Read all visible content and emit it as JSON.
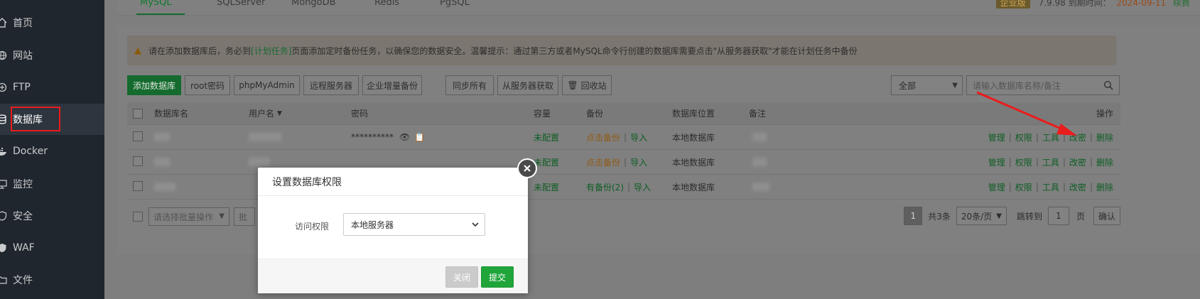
{
  "sidebar": {
    "items": [
      {
        "label": "首页",
        "icon": "home-icon"
      },
      {
        "label": "网站",
        "icon": "globe-icon"
      },
      {
        "label": "FTP",
        "icon": "ftp-icon"
      },
      {
        "label": "数据库",
        "icon": "database-icon",
        "active": true
      },
      {
        "label": "Docker",
        "icon": "docker-icon"
      },
      {
        "label": "监控",
        "icon": "monitor-icon"
      },
      {
        "label": "安全",
        "icon": "shield-icon"
      },
      {
        "label": "WAF",
        "icon": "waf-icon"
      },
      {
        "label": "文件",
        "icon": "folder-icon"
      }
    ]
  },
  "tabs": [
    {
      "label": "MySQL",
      "active": true
    },
    {
      "label": "SQLServer"
    },
    {
      "label": "MongoDB"
    },
    {
      "label": "Redis"
    },
    {
      "label": "PgSQL"
    }
  ],
  "topright": {
    "edition": "企业版",
    "version": "7.9.98",
    "expire_label": "到期时间：",
    "expire_date": "2024-09-11",
    "renew": "续费"
  },
  "notice": {
    "text_before": "请在添加数据库后，务必到",
    "link": "[计划任务]",
    "text_after": "页面添加定时备份任务，以确保您的数据安全。温馨提示：通过第三方或者MySQL命令行创建的数据库需要点击\"从服务器获取\"才能在计划任务中备份"
  },
  "toolbar": {
    "add_db": "添加数据库",
    "root_pwd": "root密码",
    "phpmyadmin": "phpMyAdmin",
    "remote_server": "远程服务器",
    "enterprise_backup": "企业增量备份",
    "sync_all": "同步所有",
    "fetch_from_server": "从服务器获取",
    "recycle_bin": "回收站",
    "filter_value": "全部",
    "search_placeholder": "请输入数据库名称/备注"
  },
  "table": {
    "headers": {
      "name": "数据库名",
      "user": "用户名",
      "password": "密码",
      "capacity": "容量",
      "backup": "备份",
      "location": "数据库位置",
      "remark": "备注",
      "actions": "操作"
    },
    "rows": [
      {
        "password": "**********",
        "capacity": "未配置",
        "backup": "点击备份",
        "import": "导入",
        "location": "本地数据库"
      },
      {
        "password": "",
        "capacity": "未配置",
        "backup": "点击备份",
        "import": "导入",
        "location": "本地数据库"
      },
      {
        "password": "",
        "capacity": "未配置",
        "backup": "有备份(2)",
        "import": "导入",
        "location": "本地数据库"
      }
    ],
    "ops": [
      "管理",
      "权限",
      "工具",
      "改密",
      "删除"
    ]
  },
  "footer": {
    "batch_placeholder": "请选择批量操作",
    "batch2": "批",
    "page": "1",
    "total": "共3条",
    "per_page": "20条/页",
    "jump_label": "跳转到",
    "jump_value": "1",
    "page_unit": "页",
    "confirm": "确认"
  },
  "modal": {
    "title": "设置数据库权限",
    "access_label": "访问权限",
    "access_value": "本地服务器",
    "close": "关闭",
    "submit": "提交"
  },
  "colors": {
    "accent_green": "#20a53a",
    "annotation_red": "#ea1c1c"
  }
}
